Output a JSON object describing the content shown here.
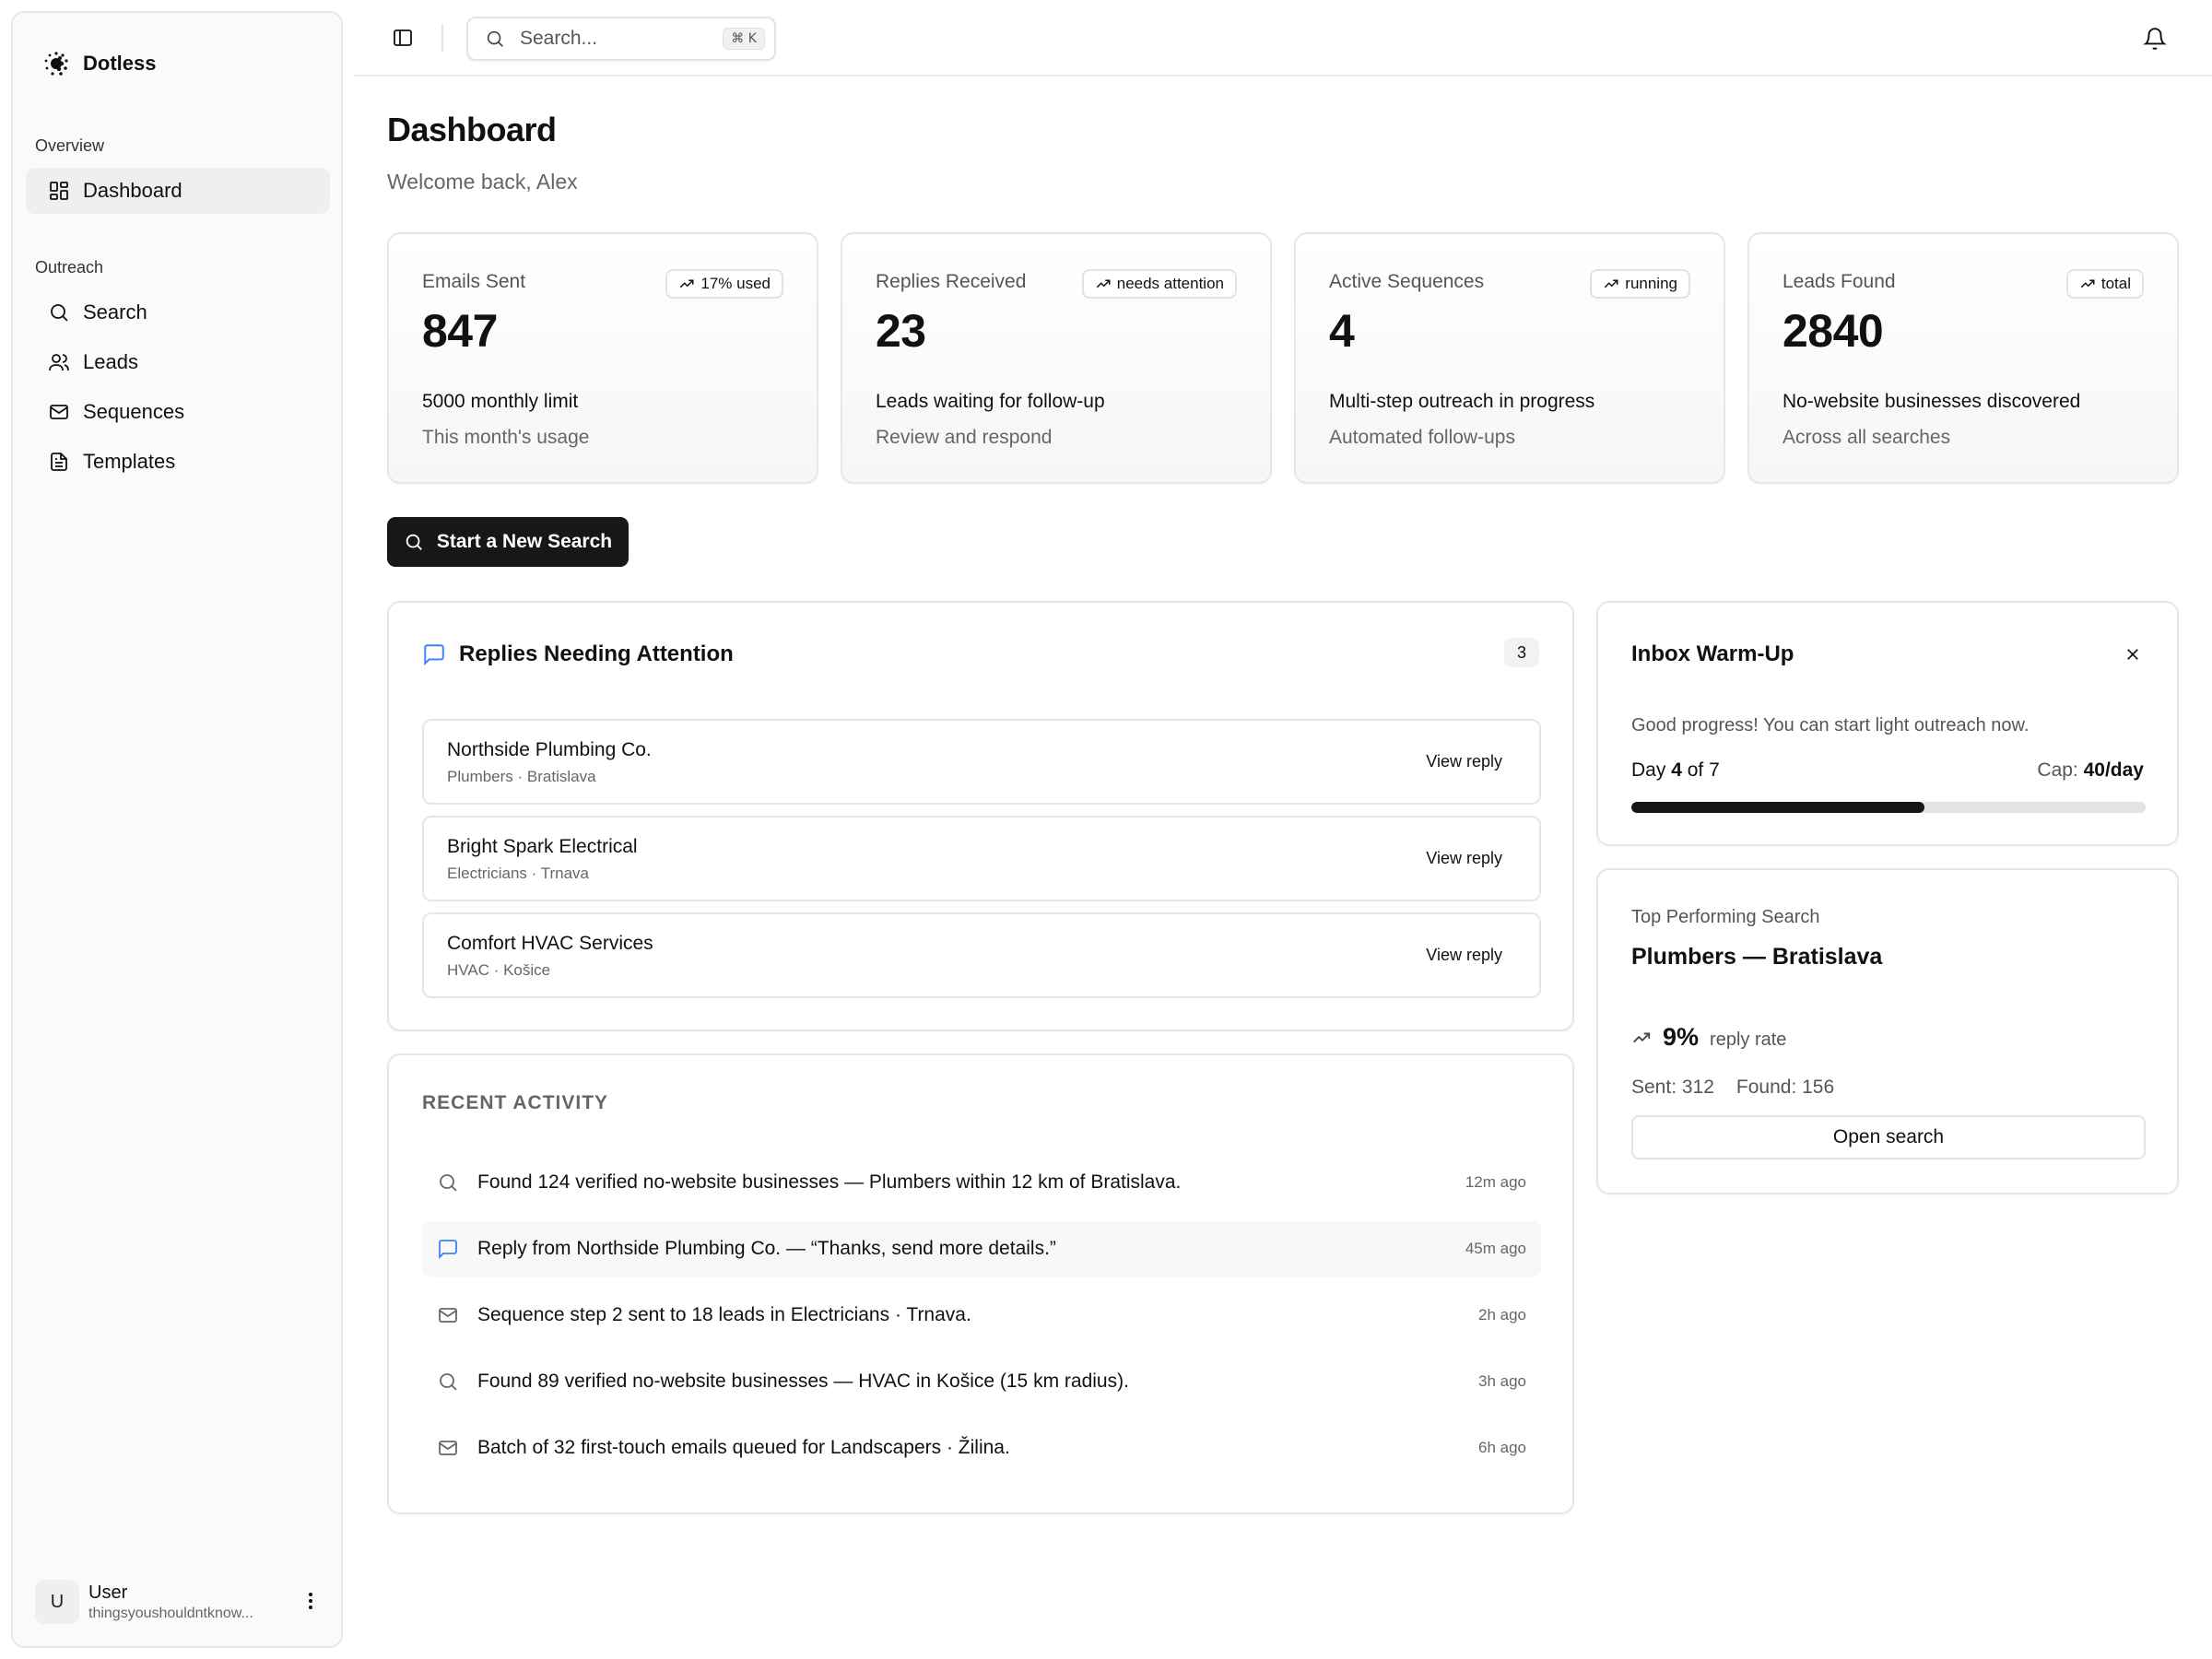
{
  "app": {
    "name": "Dotless"
  },
  "sidebar": {
    "groups": [
      {
        "label": "Overview",
        "items": [
          {
            "label": "Dashboard",
            "icon": "dashboard-icon",
            "active": true
          }
        ]
      },
      {
        "label": "Outreach",
        "items": [
          {
            "label": "Search",
            "icon": "search-icon"
          },
          {
            "label": "Leads",
            "icon": "users-icon"
          },
          {
            "label": "Sequences",
            "icon": "mail-icon"
          },
          {
            "label": "Templates",
            "icon": "file-text-icon"
          }
        ]
      }
    ],
    "user": {
      "initial": "U",
      "name": "User",
      "email": "thingsyoushouldntknow..."
    }
  },
  "topbar": {
    "search_placeholder": "Search...",
    "shortcut": "⌘ K"
  },
  "page": {
    "title": "Dashboard",
    "subtitle": "Welcome back, Alex"
  },
  "stats": [
    {
      "label": "Emails Sent",
      "badge": "17% used",
      "value": "847",
      "desc": "5000 monthly limit",
      "sub": "This month's usage"
    },
    {
      "label": "Replies Received",
      "badge": "needs attention",
      "value": "23",
      "desc": "Leads waiting for follow-up",
      "sub": "Review and respond"
    },
    {
      "label": "Active Sequences",
      "badge": "running",
      "value": "4",
      "desc": "Multi-step outreach in progress",
      "sub": "Automated follow-ups"
    },
    {
      "label": "Leads Found",
      "badge": "total",
      "value": "2840",
      "desc": "No-website businesses discovered",
      "sub": "Across all searches"
    }
  ],
  "actions": {
    "new_search": "Start a New Search"
  },
  "replies": {
    "title": "Replies Needing Attention",
    "count": "3",
    "items": [
      {
        "name": "Northside Plumbing Co.",
        "meta": "Plumbers · Bratislava",
        "action": "View reply"
      },
      {
        "name": "Bright Spark Electrical",
        "meta": "Electricians · Trnava",
        "action": "View reply"
      },
      {
        "name": "Comfort HVAC Services",
        "meta": "HVAC · Košice",
        "action": "View reply"
      }
    ]
  },
  "activity": {
    "title": "RECENT ACTIVITY",
    "items": [
      {
        "icon": "search-icon",
        "text": "Found 124 verified no-website businesses — Plumbers within 12 km of Bratislava.",
        "time": "12m ago"
      },
      {
        "icon": "message-icon",
        "text": "Reply from Northside Plumbing Co. — “Thanks, send more details.”",
        "time": "45m ago",
        "highlight": true
      },
      {
        "icon": "mail-icon",
        "text": "Sequence step 2 sent to 18 leads in Electricians · Trnava.",
        "time": "2h ago"
      },
      {
        "icon": "search-icon",
        "text": "Found 89 verified no-website businesses — HVAC in Košice (15 km radius).",
        "time": "3h ago"
      },
      {
        "icon": "mail-icon",
        "text": "Batch of 32 first-touch emails queued for Landscapers · Žilina.",
        "time": "6h ago"
      }
    ]
  },
  "warmup": {
    "title": "Inbox Warm-Up",
    "message": "Good progress! You can start light outreach now.",
    "day_prefix": "Day",
    "day": "4",
    "day_of": "of 7",
    "cap_label": "Cap:",
    "cap_value": "40/day",
    "progress": 0.57
  },
  "top_search": {
    "label": "Top Performing Search",
    "name": "Plumbers — Bratislava",
    "rate": "9%",
    "rate_label": "reply rate",
    "sent": "Sent: 312",
    "found": "Found: 156",
    "action": "Open search"
  },
  "colors": {
    "primary": "#171717",
    "accent_blue": "#3b82f6",
    "muted": "#666666",
    "border": "#e6e6e6"
  }
}
